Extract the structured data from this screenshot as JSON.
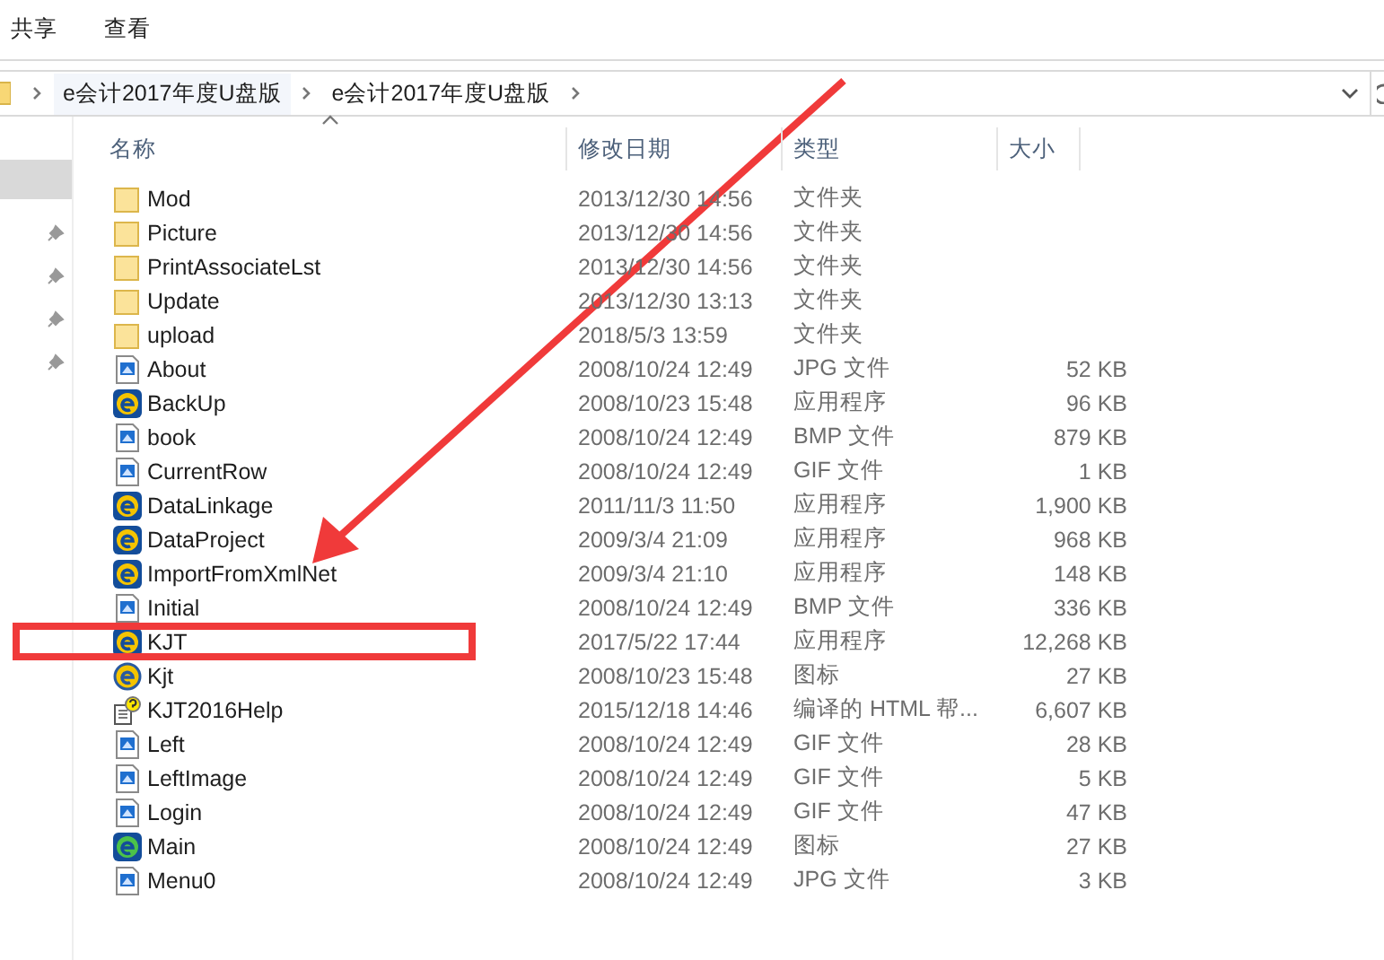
{
  "ribbon": {
    "tabs": [
      {
        "label": "共享",
        "selected": false
      },
      {
        "label": "查看",
        "selected": false
      }
    ]
  },
  "address_bar": {
    "crumbs": [
      "e会计2017年度U盘版",
      "e会计2017年度U盘版"
    ]
  },
  "table": {
    "columns": [
      "名称",
      "修改日期",
      "类型",
      "大小"
    ],
    "rows": [
      {
        "kind": "folder",
        "name": "Mod",
        "date": "2013/12/30 14:56",
        "type": "文件夹",
        "size": "",
        "highlighted": false
      },
      {
        "kind": "folder",
        "name": "Picture",
        "date": "2013/12/30 14:56",
        "type": "文件夹",
        "size": "",
        "highlighted": false
      },
      {
        "kind": "folder",
        "name": "PrintAssociateLst",
        "date": "2013/12/30 14:56",
        "type": "文件夹",
        "size": "",
        "highlighted": false
      },
      {
        "kind": "folder",
        "name": "Update",
        "date": "2013/12/30 13:13",
        "type": "文件夹",
        "size": "",
        "highlighted": false
      },
      {
        "kind": "folder",
        "name": "upload",
        "date": "2018/5/3 13:59",
        "type": "文件夹",
        "size": "",
        "highlighted": false
      },
      {
        "kind": "image",
        "name": "About",
        "date": "2008/10/24 12:49",
        "type": "JPG 文件",
        "size": "52 KB",
        "highlighted": false
      },
      {
        "kind": "app",
        "name": "BackUp",
        "date": "2008/10/23 15:48",
        "type": "应用程序",
        "size": "96 KB",
        "highlighted": false
      },
      {
        "kind": "image",
        "name": "book",
        "date": "2008/10/24 12:49",
        "type": "BMP 文件",
        "size": "879 KB",
        "highlighted": false
      },
      {
        "kind": "image",
        "name": "CurrentRow",
        "date": "2008/10/24 12:49",
        "type": "GIF 文件",
        "size": "1 KB",
        "highlighted": false
      },
      {
        "kind": "app",
        "name": "DataLinkage",
        "date": "2011/11/3 11:50",
        "type": "应用程序",
        "size": "1,900 KB",
        "highlighted": false
      },
      {
        "kind": "app",
        "name": "DataProject",
        "date": "2009/3/4 21:09",
        "type": "应用程序",
        "size": "968 KB",
        "highlighted": false
      },
      {
        "kind": "app",
        "name": "ImportFromXmlNet",
        "date": "2009/3/4 21:10",
        "type": "应用程序",
        "size": "148 KB",
        "highlighted": false
      },
      {
        "kind": "image",
        "name": "Initial",
        "date": "2008/10/24 12:49",
        "type": "BMP 文件",
        "size": "336 KB",
        "highlighted": false
      },
      {
        "kind": "app",
        "name": "KJT",
        "date": "2017/5/22 17:44",
        "type": "应用程序",
        "size": "12,268 KB",
        "highlighted": true
      },
      {
        "kind": "ico",
        "name": "Kjt",
        "date": "2008/10/23 15:48",
        "type": "图标",
        "size": "27 KB",
        "highlighted": false
      },
      {
        "kind": "help",
        "name": "KJT2016Help",
        "date": "2015/12/18 14:46",
        "type": "编译的 HTML 帮...",
        "size": "6,607 KB",
        "highlighted": false
      },
      {
        "kind": "image",
        "name": "Left",
        "date": "2008/10/24 12:49",
        "type": "GIF 文件",
        "size": "28 KB",
        "highlighted": false
      },
      {
        "kind": "image",
        "name": "LeftImage",
        "date": "2008/10/24 12:49",
        "type": "GIF 文件",
        "size": "5 KB",
        "highlighted": false
      },
      {
        "kind": "image",
        "name": "Login",
        "date": "2008/10/24 12:49",
        "type": "GIF 文件",
        "size": "47 KB",
        "highlighted": false
      },
      {
        "kind": "app-green",
        "name": "Main",
        "date": "2008/10/24 12:49",
        "type": "图标",
        "size": "27 KB",
        "highlighted": false
      },
      {
        "kind": "image",
        "name": "Menu0",
        "date": "2008/10/24 12:49",
        "type": "JPG 文件",
        "size": "3 KB",
        "highlighted": false
      }
    ]
  }
}
